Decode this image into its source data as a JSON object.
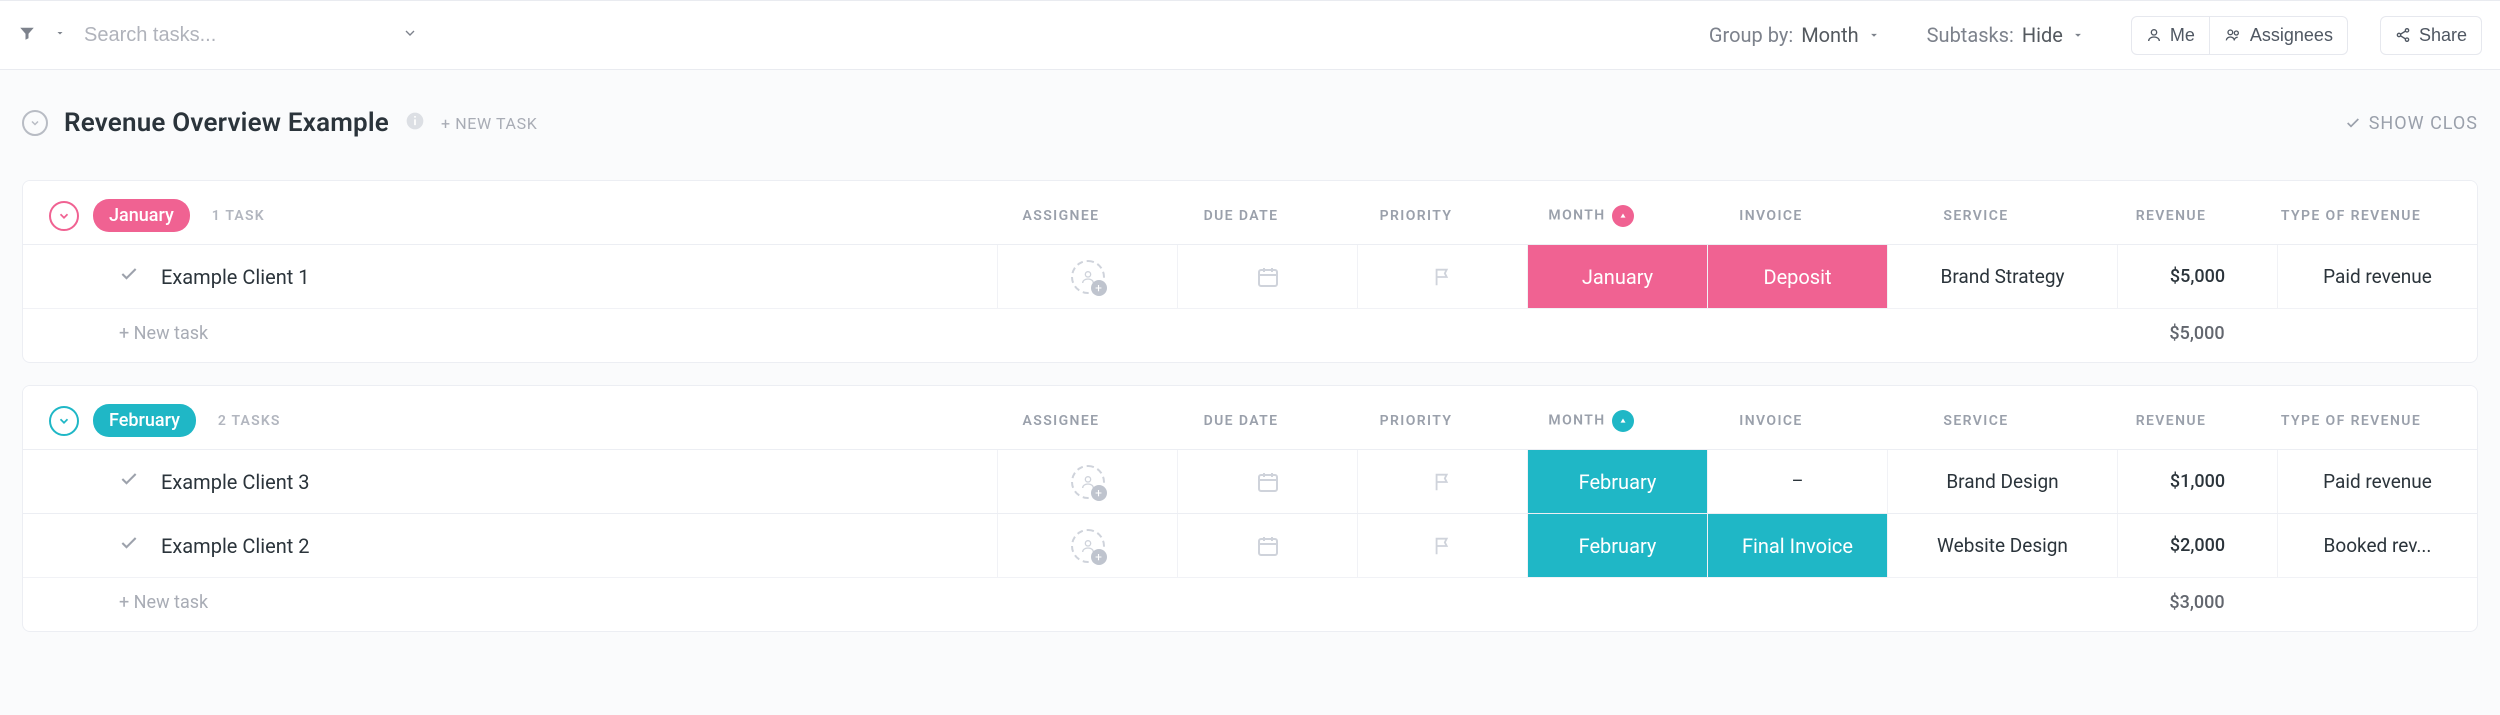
{
  "toolbar": {
    "search_placeholder": "Search tasks...",
    "group_by_label": "Group by:",
    "group_by_value": "Month",
    "subtasks_label": "Subtasks:",
    "subtasks_value": "Hide",
    "me_label": "Me",
    "assignees_label": "Assignees",
    "share_label": "Share"
  },
  "header": {
    "title": "Revenue Overview Example",
    "new_task_label": "+ NEW TASK",
    "show_closed_label": "SHOW CLOS"
  },
  "columns": {
    "assignee": "ASSIGNEE",
    "due": "DUE DATE",
    "priority": "PRIORITY",
    "month": "MONTH",
    "invoice": "INVOICE",
    "service": "SERVICE",
    "revenue": "REVENUE",
    "type": "TYPE OF REVENUE"
  },
  "new_task_row": "+ New task",
  "groups": [
    {
      "name": "January",
      "count_label": "1 TASK",
      "color": "pink",
      "rows": [
        {
          "title": "Example Client 1",
          "month": "January",
          "invoice": "Deposit",
          "service": "Brand Strategy",
          "revenue": "$5,000",
          "type": "Paid revenue"
        }
      ],
      "total": "$5,000"
    },
    {
      "name": "February",
      "count_label": "2 TASKS",
      "color": "teal",
      "rows": [
        {
          "title": "Example Client 3",
          "month": "February",
          "invoice": "–",
          "service": "Brand Design",
          "revenue": "$1,000",
          "type": "Paid revenue"
        },
        {
          "title": "Example Client 2",
          "month": "February",
          "invoice": "Final Invoice",
          "service": "Website Design",
          "revenue": "$2,000",
          "type": "Booked rev..."
        }
      ],
      "total": "$3,000"
    }
  ]
}
